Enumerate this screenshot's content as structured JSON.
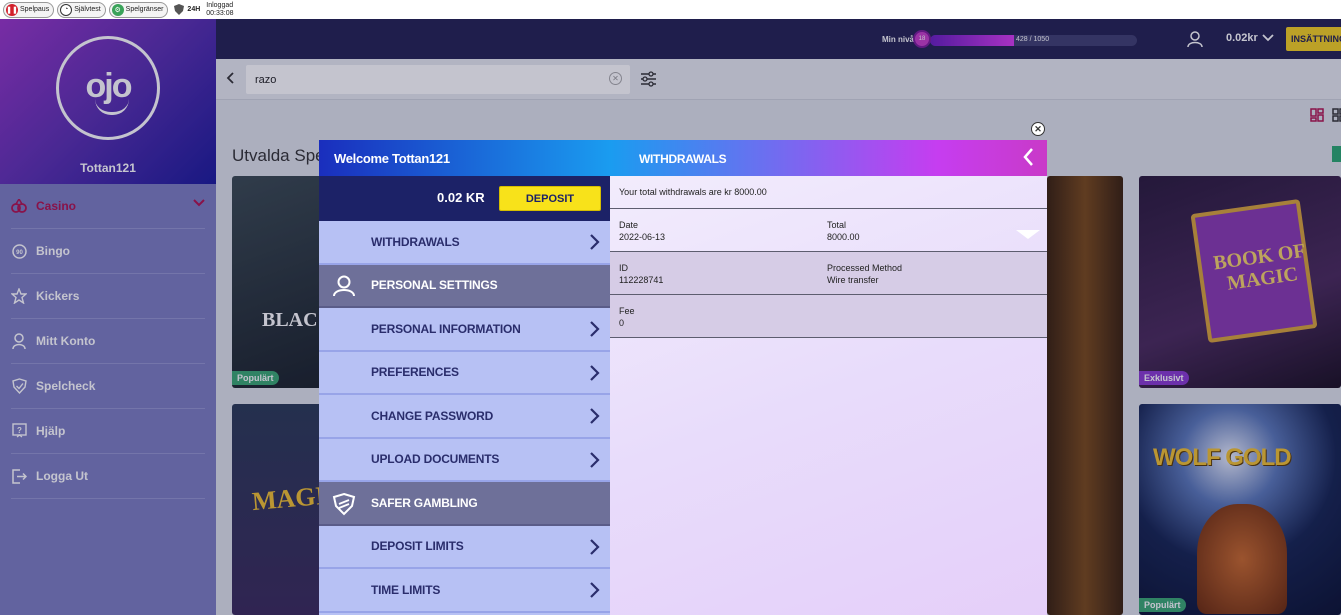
{
  "topbar": {
    "spelpaus": "Spelpaus",
    "sjalvtest": "Självtest",
    "spelgranser": "Spelgränser",
    "h24": "24H",
    "logged_label": "Inloggad",
    "logged_time": "00:33:08"
  },
  "header": {
    "level_label": "Min nivå",
    "level_badge": "18",
    "level_progress_text": "428 / 1050",
    "level_progress_fraction": 0.408,
    "balance": "0.02kr",
    "deposit_label": "INSÄTTNING"
  },
  "sidebar": {
    "username": "Tottan121",
    "items": [
      {
        "label": "Casino",
        "icon": "casino-icon"
      },
      {
        "label": "Bingo",
        "icon": "bingo-icon"
      },
      {
        "label": "Kickers",
        "icon": "star-icon"
      },
      {
        "label": "Mitt Konto",
        "icon": "user-icon"
      },
      {
        "label": "Spelcheck",
        "icon": "shield-check-icon"
      },
      {
        "label": "Hjälp",
        "icon": "help-icon"
      },
      {
        "label": "Logga Ut",
        "icon": "logout-icon"
      }
    ]
  },
  "search": {
    "value": "razo"
  },
  "content": {
    "section_title": "Utvalda Spe",
    "tiles": [
      {
        "tag": "Populärt",
        "text": "BLAC"
      },
      {
        "tag": "",
        "text": "MAGI"
      },
      {
        "tag": "Exklusivt",
        "text": "BOOK OF MAGIC"
      },
      {
        "tag": "Populärt",
        "text": "WOLF GOLD"
      }
    ]
  },
  "modal": {
    "welcome": "Welcome Tottan121",
    "title": "WITHDRAWALS",
    "balance": "0.02 KR",
    "deposit_label": "DEPOSIT",
    "menu": [
      {
        "label": "WITHDRAWALS",
        "header": false
      },
      {
        "label": "PERSONAL SETTINGS",
        "header": true
      },
      {
        "label": "PERSONAL INFORMATION",
        "header": false
      },
      {
        "label": "PREFERENCES",
        "header": false
      },
      {
        "label": "CHANGE PASSWORD",
        "header": false
      },
      {
        "label": "UPLOAD DOCUMENTS",
        "header": false
      },
      {
        "label": "SAFER GAMBLING",
        "header": true
      },
      {
        "label": "DEPOSIT LIMITS",
        "header": false
      },
      {
        "label": "TIME LIMITS",
        "header": false
      }
    ],
    "withdrawals": {
      "total_text": "Your total withdrawals are  kr 8000.00",
      "date_label": "Date",
      "date_value": "2022-06-13",
      "total_label": "Total",
      "total_value": "8000.00",
      "id_label": "ID",
      "id_value": "112228741",
      "method_label": "Processed Method",
      "method_value": "Wire transfer",
      "fee_label": "Fee",
      "fee_value": "0"
    }
  }
}
